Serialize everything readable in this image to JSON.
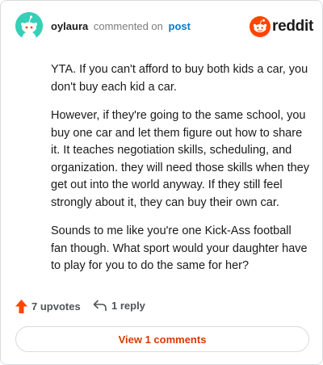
{
  "header": {
    "username": "oylaura",
    "action_text": "commented on",
    "post_link": "post",
    "brand": "reddit"
  },
  "comment": {
    "paragraphs": [
      "YTA. If you can't afford to buy both kids a car, you don't buy each kid a car.",
      "However, if they're going to the same school, you buy one car and let them figure out how to share it. It teaches negotiation skills, scheduling, and organization. they will need those skills when they get out into the world anyway. If they still feel strongly about it, they can buy their own car.",
      "Sounds to me like you're one Kick-Ass football fan though. What sport would your daughter have to play for you to do the same for her?"
    ]
  },
  "footer": {
    "upvotes_label": "7 upvotes",
    "reply_label": "1 reply",
    "view_comments_label": "View 1 comments"
  },
  "icons": {
    "avatar": "snoo-avatar-icon",
    "brand_logo": "reddit-logo-icon",
    "upvote": "upvote-arrow-icon",
    "reply": "reply-arrow-icon"
  },
  "colors": {
    "brand_orange": "#ff4500",
    "avatar_bg": "#35d0b6",
    "link_blue": "#0079d3",
    "view_button_text": "#d93a00"
  }
}
